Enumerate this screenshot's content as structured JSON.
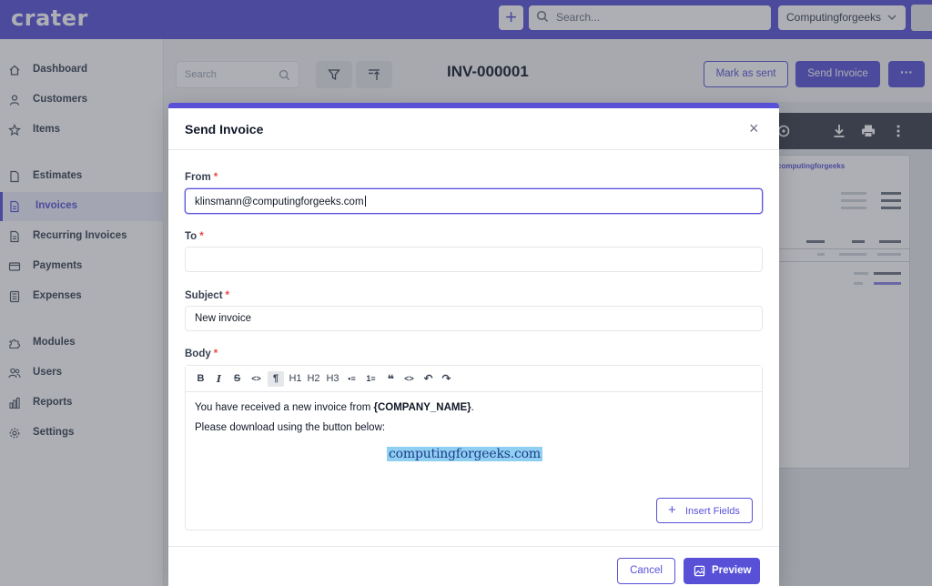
{
  "app": {
    "logo": "crater",
    "search_placeholder": "Search...",
    "company": "Computingforgeeks",
    "add_button": "+"
  },
  "sidebar": {
    "items": [
      {
        "label": "Dashboard",
        "icon": "home-icon"
      },
      {
        "label": "Customers",
        "icon": "user-icon"
      },
      {
        "label": "Items",
        "icon": "star-icon"
      },
      {
        "label": "Estimates",
        "icon": "document-icon"
      },
      {
        "label": "Invoices",
        "icon": "document-text-icon",
        "active": true
      },
      {
        "label": "Recurring Invoices",
        "icon": "document-duplicate-icon"
      },
      {
        "label": "Payments",
        "icon": "credit-card-icon"
      },
      {
        "label": "Expenses",
        "icon": "calculator-icon"
      },
      {
        "label": "Modules",
        "icon": "puzzle-icon"
      },
      {
        "label": "Users",
        "icon": "users-icon"
      },
      {
        "label": "Reports",
        "icon": "chart-bar-icon"
      },
      {
        "label": "Settings",
        "icon": "cog-icon"
      }
    ]
  },
  "list": {
    "search_placeholder": "Search"
  },
  "invoice_header": {
    "number": "INV-000001",
    "mark_as_sent": "Mark as sent",
    "send_invoice": "Send Invoice",
    "more": "···"
  },
  "preview_doc": {
    "company": "computingforgeeks"
  },
  "modal": {
    "title": "Send Invoice",
    "close": "×",
    "from_label": "From",
    "from_value": "klinsmann@computingforgeeks.com",
    "to_label": "To",
    "to_value": "",
    "subject_label": "Subject",
    "subject_value": "New invoice",
    "body_label": "Body",
    "required_mark": "*",
    "toolbar": [
      "B",
      "I",
      "S",
      "<>",
      "¶",
      "H1",
      "H2",
      "H3",
      "•≡",
      "1≡",
      "❝",
      "<>",
      "↶",
      "↷"
    ],
    "body_line1_prefix": "You have received a new invoice from ",
    "body_line1_field": "{COMPANY_NAME}",
    "body_line1_suffix": ".",
    "body_line2": "Please download using the button below:",
    "watermark": "computingforgeeks.com",
    "insert_fields": "Insert Fields",
    "cancel": "Cancel",
    "preview": "Preview"
  },
  "colors": {
    "accent": "#5851d8",
    "required": "#ef4444"
  }
}
